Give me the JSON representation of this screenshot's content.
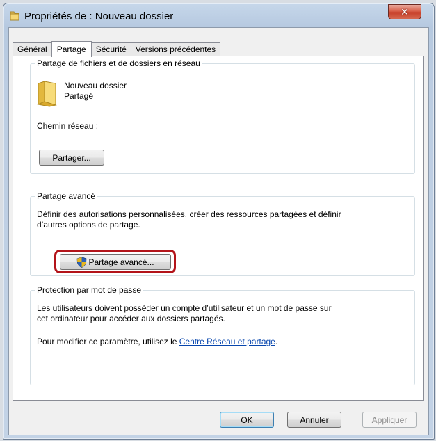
{
  "window": {
    "title": "Propriétés de : Nouveau dossier"
  },
  "tabs": [
    {
      "label": "Général"
    },
    {
      "label": "Partage",
      "active": true
    },
    {
      "label": "Sécurité"
    },
    {
      "label": "Versions précédentes"
    }
  ],
  "network_share": {
    "legend": "Partage de fichiers et de dossiers en réseau",
    "folder_name": "Nouveau dossier",
    "folder_status": "Partagé",
    "path_label": "Chemin réseau :",
    "share_button": "Partager..."
  },
  "advanced_share": {
    "legend": "Partage avancé",
    "description_line1": "Définir des autorisations personnalisées, créer des ressources partagées et définir",
    "description_line2": "d’autres options de partage.",
    "button": "Partage avancé..."
  },
  "password_protection": {
    "legend": "Protection par mot de passe",
    "line1": "Les utilisateurs doivent posséder un compte d’utilisateur et un mot de passe sur",
    "line2": "cet ordinateur pour accéder aux dossiers partagés.",
    "change_prefix": "Pour modifier ce paramètre, utilisez le ",
    "change_link": "Centre Réseau et partage",
    "change_suffix": "."
  },
  "footer": {
    "ok": "OK",
    "cancel": "Annuler",
    "apply": "Appliquer"
  },
  "colors": {
    "highlight": "#b3141a",
    "link": "#0645ad"
  },
  "icons": {
    "title": "folder-icon",
    "close": "close-icon",
    "folder": "folder-icon",
    "uac": "uac-shield-icon"
  }
}
